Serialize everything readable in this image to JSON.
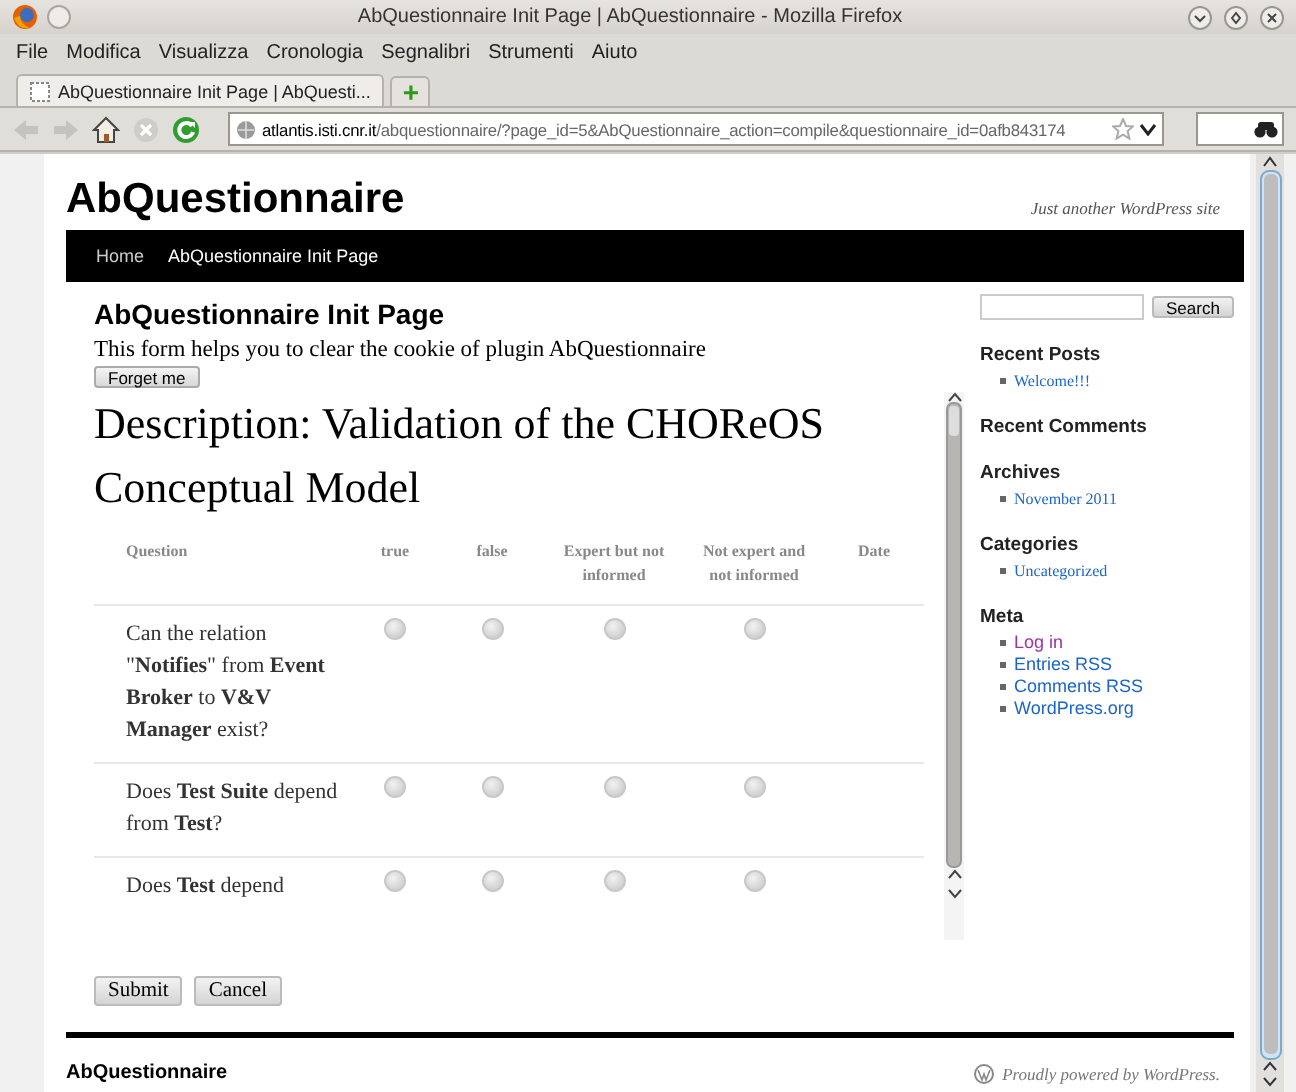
{
  "window": {
    "title": "AbQuestionnaire Init Page | AbQuestionnaire - Mozilla Firefox"
  },
  "menu": [
    "File",
    "Modifica",
    "Visualizza",
    "Cronologia",
    "Segnalibri",
    "Strumenti",
    "Aiuto"
  ],
  "tabs": [
    {
      "label": "AbQuestionnaire Init Page | AbQuesti...",
      "selected": true
    }
  ],
  "new_tab": "+",
  "address_bar": {
    "domain": "atlantis.isti.cnr.it",
    "path": "/abquestionnaire/?page_id=5&AbQuestionnaire_action=compile&questionnaire_id=0afb843174"
  },
  "site": {
    "title": "AbQuestionnaire",
    "tagline": "Just another WordPress site",
    "nav": [
      {
        "label": "Home",
        "selected": false
      },
      {
        "label": "AbQuestionnaire Init Page",
        "selected": true
      }
    ]
  },
  "content": {
    "heading": "AbQuestionnaire Init Page",
    "intro": "This form helps you to clear the cookie of plugin AbQuestionnaire",
    "forget_button": "Forget me",
    "description": "Description: Validation of the CHOReOS Conceptual Model",
    "table": {
      "columns": [
        "Question",
        "true",
        "false",
        "Expert but not informed",
        "Not expert and not informed",
        "Date"
      ],
      "rows": [
        {
          "question": "Can the relation \"**Notifies**\" from **Event Broker** to **V&V Manager** exist?",
          "answers": [
            {
              "selected": false
            },
            {
              "selected": false
            },
            {
              "selected": false
            },
            {
              "selected": false
            }
          ]
        },
        {
          "question": "Does **Test Suite** depend from **Test**?",
          "answers": [
            {
              "selected": false
            },
            {
              "selected": false
            },
            {
              "selected": false
            },
            {
              "selected": false
            }
          ]
        },
        {
          "question": "Does **Test** depend",
          "answers": [
            {
              "selected": false
            },
            {
              "selected": false
            },
            {
              "selected": false
            },
            {
              "selected": false
            }
          ]
        }
      ]
    },
    "buttons": [
      "Submit",
      "Cancel"
    ]
  },
  "sidebar": {
    "search_button": "Search",
    "sections": [
      {
        "title": "Recent Posts",
        "items": [
          {
            "label": "Welcome!!!",
            "visited": false
          }
        ]
      },
      {
        "title": "Recent Comments"
      },
      {
        "title": "Archives",
        "items": [
          {
            "label": "November 2011",
            "visited": false
          }
        ]
      },
      {
        "title": "Categories",
        "items": [
          {
            "label": "Uncategorized",
            "visited": false
          }
        ]
      },
      {
        "title": "Meta",
        "kind": "meta",
        "items": [
          {
            "label": "Log in",
            "visited": true
          },
          {
            "label": "Entries RSS",
            "visited": false
          },
          {
            "label": "Comments RSS",
            "visited": false
          },
          {
            "label": "WordPress.org",
            "visited": false
          }
        ]
      }
    ]
  },
  "footer": {
    "site": "AbQuestionnaire",
    "credit": "Proudly powered by WordPress."
  }
}
